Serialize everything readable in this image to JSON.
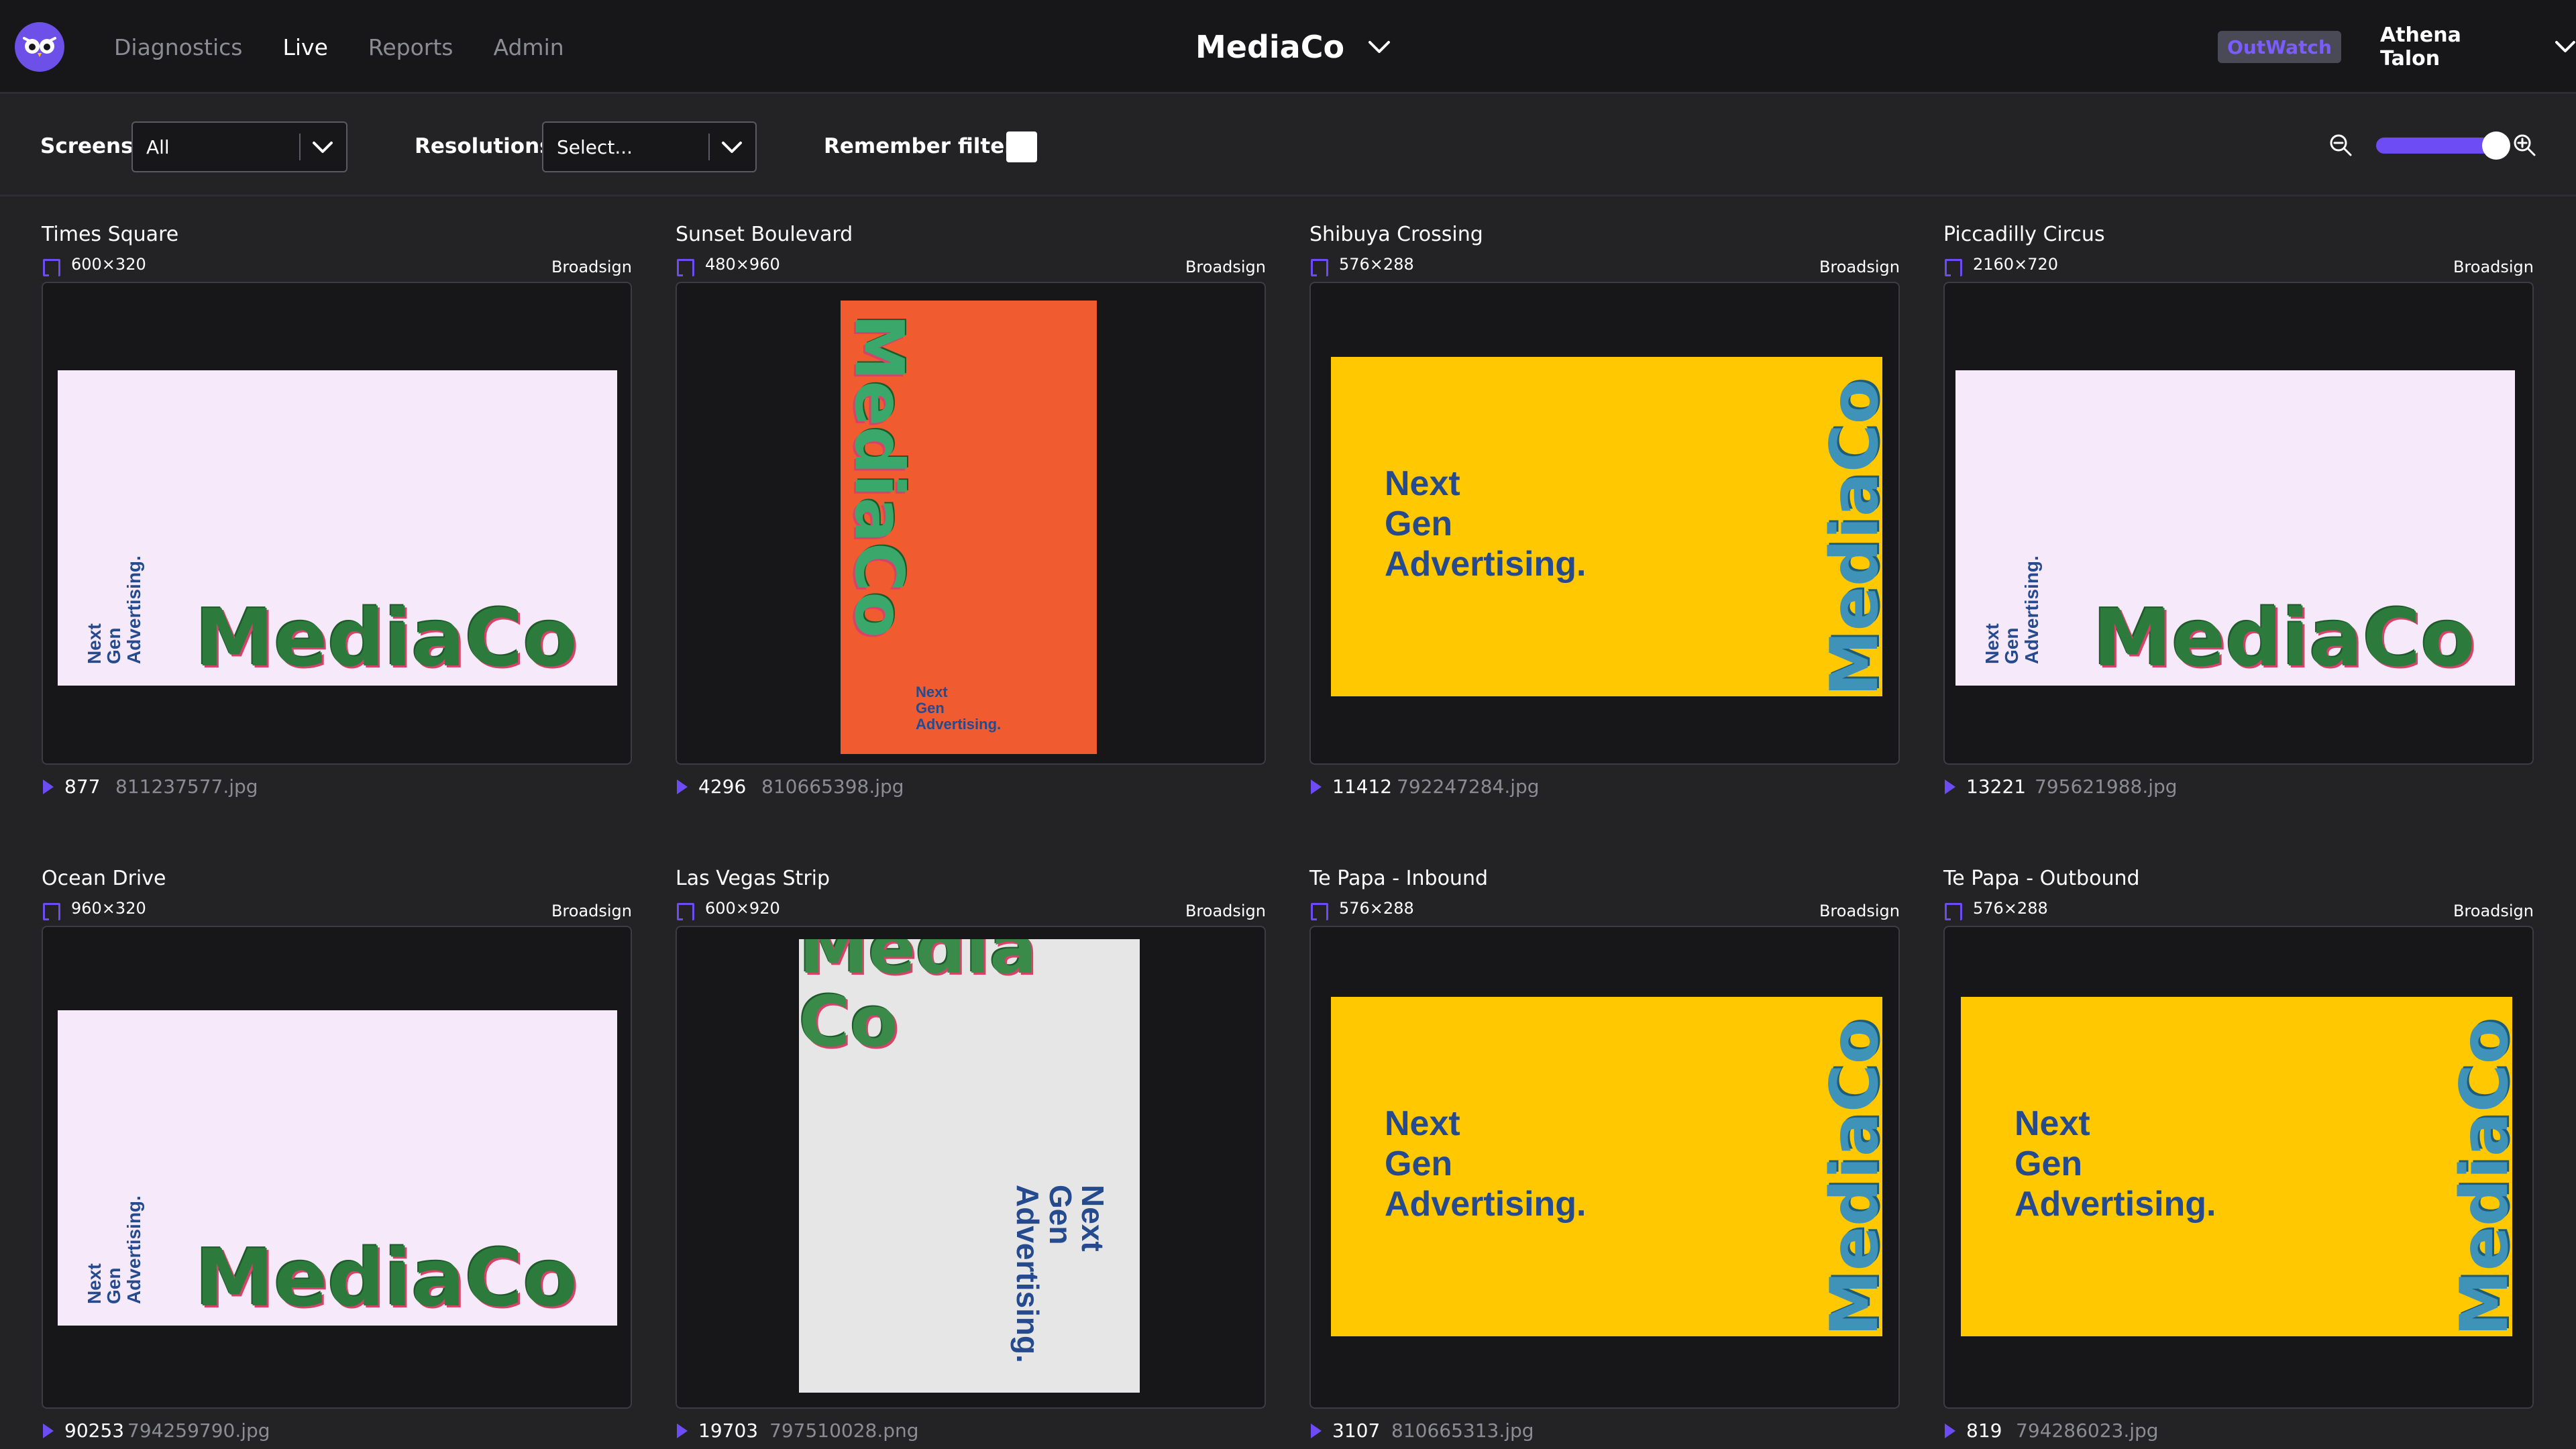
{
  "header": {
    "nav": [
      "Diagnostics",
      "Live",
      "Reports",
      "Admin"
    ],
    "active_nav": "Live",
    "org_name": "MediaCo",
    "badge": "OutWatch",
    "user_name": "Athena Talon"
  },
  "filters": {
    "screens_label": "Screens",
    "screens_value": "All",
    "resolutions_label": "Resolutions",
    "resolutions_value": "Select...",
    "remember_label": "Remember filters",
    "remember_checked": false,
    "zoom_level": 0.9
  },
  "colors": {
    "accent": "#6d4cf5",
    "pink_bg": "#f6eafa",
    "yellow_bg": "#ffc800",
    "orange_bg": "#f05c30",
    "grey_bg": "#e6e6e6",
    "ad_text": "#254a8e"
  },
  "creative": {
    "brand": "MediaCo",
    "tagline_1": "Next",
    "tagline_2": "Gen",
    "tagline_3": "Advertising.",
    "brand_partial": "Media",
    "brand_split_1": "Media",
    "brand_split_2": "Co"
  },
  "screens": [
    {
      "name": "Times Square",
      "resolution": "600×320",
      "vendor": "Broadsign",
      "plays": "877",
      "file": "811237577.jpg"
    },
    {
      "name": "Sunset Boulevard",
      "resolution": "480×960",
      "vendor": "Broadsign",
      "plays": "4296",
      "file": "810665398.jpg"
    },
    {
      "name": "Shibuya Crossing",
      "resolution": "576×288",
      "vendor": "Broadsign",
      "plays": "11412",
      "file": "792247284.jpg"
    },
    {
      "name": "Piccadilly Circus",
      "resolution": "2160×720",
      "vendor": "Broadsign",
      "plays": "13221",
      "file": "795621988.jpg"
    },
    {
      "name": "Ocean Drive",
      "resolution": "960×320",
      "vendor": "Broadsign",
      "plays": "90253",
      "file": "794259790.jpg"
    },
    {
      "name": "Las Vegas Strip",
      "resolution": "600×920",
      "vendor": "Broadsign",
      "plays": "19703",
      "file": "797510028.png"
    },
    {
      "name": "Te Papa - Inbound",
      "resolution": "576×288",
      "vendor": "Broadsign",
      "plays": "3107",
      "file": "810665313.jpg"
    },
    {
      "name": "Te Papa - Outbound",
      "resolution": "576×288",
      "vendor": "Broadsign",
      "plays": "819",
      "file": "794286023.jpg"
    }
  ]
}
